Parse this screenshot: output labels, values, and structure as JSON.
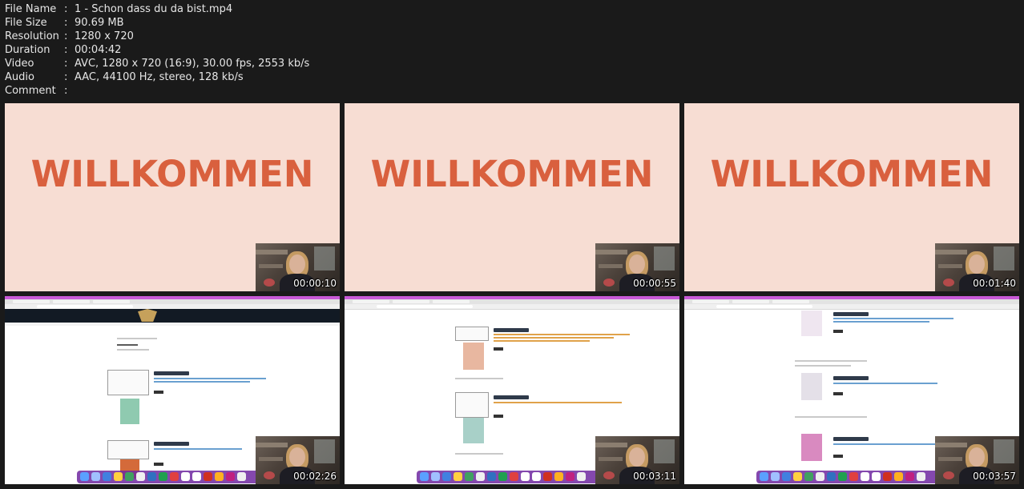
{
  "meta": [
    {
      "key": "File Name",
      "value": "1 - Schon dass du da bist.mp4"
    },
    {
      "key": "File Size",
      "value": "90.69 MB"
    },
    {
      "key": "Resolution",
      "value": "1280 x 720"
    },
    {
      "key": "Duration",
      "value": "00:04:42"
    },
    {
      "key": "Video",
      "value": "AVC, 1280 x 720 (16:9), 30.00 fps, 2553 kb/s"
    },
    {
      "key": "Audio",
      "value": "AAC, 44100 Hz, stereo, 128 kb/s"
    },
    {
      "key": "Comment",
      "value": ""
    }
  ],
  "colon": ":",
  "thumbnails": [
    {
      "timestamp": "00:00:10",
      "title": "WILLKOMMEN"
    },
    {
      "timestamp": "00:00:55",
      "title": "WILLKOMMEN"
    },
    {
      "timestamp": "00:01:40",
      "title": "WILLKOMMEN"
    },
    {
      "timestamp": "00:02:26"
    },
    {
      "timestamp": "00:03:11"
    },
    {
      "timestamp": "00:03:57"
    }
  ],
  "colors": {
    "background": "#1a1a1a",
    "slide_background": "#f7ddd3",
    "slide_title": "#d9603e",
    "dock": "#6e28a0"
  }
}
